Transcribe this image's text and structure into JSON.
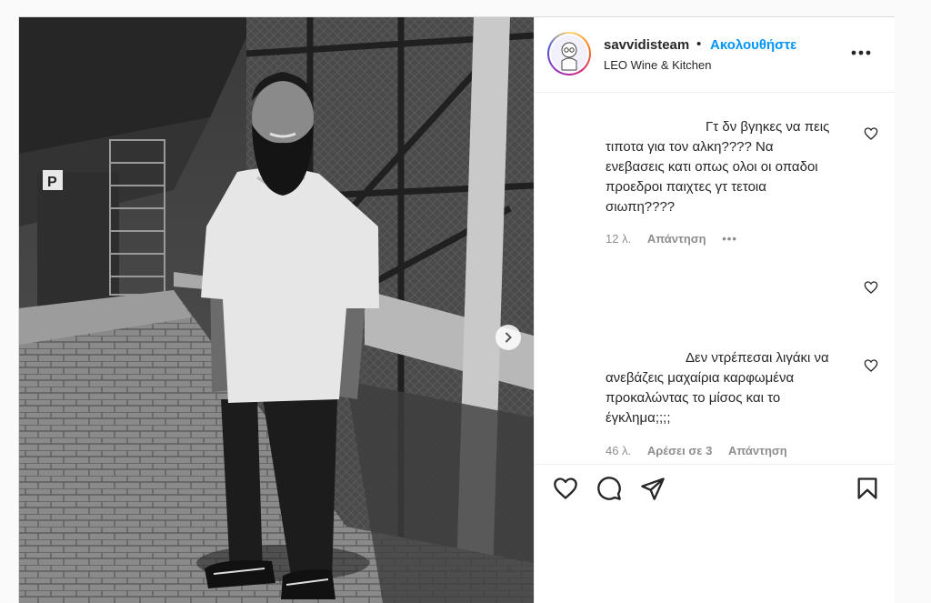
{
  "post": {
    "username": "savvidisteam",
    "separator": "•",
    "follow_label": "Ακολουθήστε",
    "location": "LEO Wine & Kitchen"
  },
  "comments": [
    {
      "text_lines": [
        "Γτ δν βγηκες να πεις",
        "τιποτα για τον αλκη???? Να",
        "ενεβασεις κατι οπως ολοι οι οπαδοι",
        "προεδροι παιχτες γτ τετοια",
        "σιωπη????"
      ],
      "time": "12 λ.",
      "reply_label": "Απάντηση",
      "more_label": "•••"
    },
    {
      "text_lines": [
        "Δεν ντρέπεσαι λιγάκι να",
        "ανεβάζεις μαχαίρια καρφωμένα",
        "προκαλώντας το μίσος και το",
        "έγκλημα;;;;"
      ],
      "time": "46 λ.",
      "likes_label": "Αρέσει σε 3",
      "reply_label": "Απάντηση"
    }
  ],
  "icons": {
    "like": "heart-icon",
    "comment": "comment-icon",
    "share": "paper-plane-icon",
    "save": "bookmark-icon",
    "next": "chevron-right-icon",
    "more": "more-horizontal-icon"
  },
  "colors": {
    "accent": "#0095f6",
    "secondary_text": "#8e8e8e",
    "border": "#dbdbdb"
  }
}
